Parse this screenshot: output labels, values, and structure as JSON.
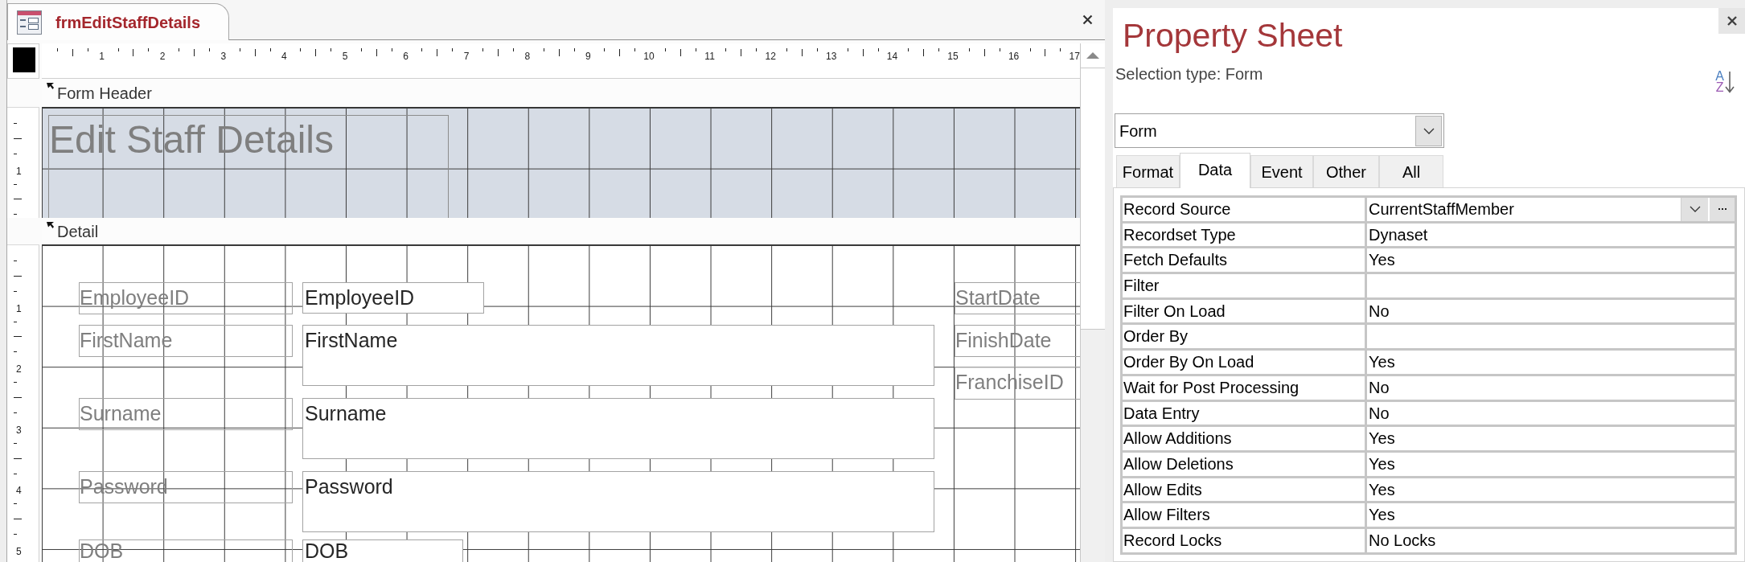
{
  "document_tab": {
    "title": "frmEditStaffDetails"
  },
  "horizontal_ruler": [
    "1",
    "2",
    "3",
    "4",
    "5",
    "6",
    "7",
    "8",
    "9",
    "10",
    "11",
    "12",
    "13",
    "14",
    "15",
    "16",
    "17"
  ],
  "sections": [
    {
      "kind": "header",
      "title": "Form Header",
      "ruler": [
        "1"
      ],
      "controls": [
        {
          "kind": "title",
          "text": "Edit Staff Details"
        }
      ]
    },
    {
      "kind": "detail",
      "title": "Detail",
      "ruler": [
        "1",
        "2",
        "3",
        "4",
        "5"
      ],
      "controls": [
        {
          "kind": "label",
          "text": "EmployeeID"
        },
        {
          "kind": "textbox",
          "text": "EmployeeID"
        },
        {
          "kind": "label",
          "text": "StartDate"
        },
        {
          "kind": "label",
          "text": "FirstName"
        },
        {
          "kind": "textbox",
          "text": "FirstName"
        },
        {
          "kind": "label",
          "text": "FinishDate"
        },
        {
          "kind": "label",
          "text": "FranchiseID"
        },
        {
          "kind": "label",
          "text": "Surname"
        },
        {
          "kind": "textbox",
          "text": "Surname"
        },
        {
          "kind": "label",
          "text": "Password"
        },
        {
          "kind": "textbox",
          "text": "Password"
        },
        {
          "kind": "label",
          "text": "DOB"
        },
        {
          "kind": "textbox",
          "text": "DOB"
        }
      ]
    }
  ],
  "property_sheet": {
    "title": "Property Sheet",
    "selection_type": "Selection type: Form",
    "sort_button": {
      "letters": [
        "A",
        "Z"
      ]
    },
    "object_selector": {
      "value": "Form"
    },
    "tabs": [
      {
        "label": "Format",
        "selected": false
      },
      {
        "label": "Data",
        "selected": true
      },
      {
        "label": "Event",
        "selected": false
      },
      {
        "label": "Other",
        "selected": false
      },
      {
        "label": "All",
        "selected": false
      }
    ],
    "properties": [
      {
        "name": "Record Source",
        "value": "CurrentStaffMember",
        "selected": true
      },
      {
        "name": "Recordset Type",
        "value": "Dynaset",
        "selected": false
      },
      {
        "name": "Fetch Defaults",
        "value": "Yes",
        "selected": false
      },
      {
        "name": "Filter",
        "selected": false
      },
      {
        "name": "Filter On Load",
        "value": "No",
        "selected": false
      },
      {
        "name": "Order By",
        "selected": false
      },
      {
        "name": "Order By On Load",
        "value": "Yes",
        "selected": false
      },
      {
        "name": "Wait for Post Processing",
        "value": "No",
        "selected": false
      },
      {
        "name": "Data Entry",
        "value": "No",
        "selected": false
      },
      {
        "name": "Allow Additions",
        "value": "Yes",
        "selected": false
      },
      {
        "name": "Allow Deletions",
        "value": "Yes",
        "selected": false
      },
      {
        "name": "Allow Edits",
        "value": "Yes",
        "selected": false
      },
      {
        "name": "Allow Filters",
        "value": "Yes",
        "selected": false
      },
      {
        "name": "Record Locks",
        "value": "No Locks",
        "selected": false
      }
    ]
  }
}
